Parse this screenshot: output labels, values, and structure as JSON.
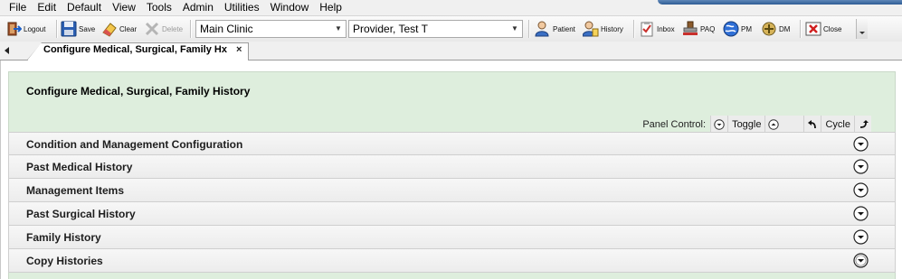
{
  "menu": [
    "File",
    "Edit",
    "Default",
    "View",
    "Tools",
    "Admin",
    "Utilities",
    "Window",
    "Help"
  ],
  "toolbar": {
    "logout": "Logout",
    "save": "Save",
    "clear": "Clear",
    "delete": "Delete",
    "clinic_value": "Main Clinic",
    "provider_value": "Provider, Test T",
    "patient": "Patient",
    "history": "History",
    "inbox": "Inbox",
    "paq": "PAQ",
    "pm": "PM",
    "dm": "DM",
    "close": "Close"
  },
  "tab": {
    "label": "Configure Medical, Surgical, Family Hx",
    "close": "×"
  },
  "page": {
    "title": "Configure Medical, Surgical, Family History",
    "panel_control": {
      "label": "Panel Control:",
      "toggle": "Toggle",
      "cycle": "Cycle"
    }
  },
  "sections": [
    "Condition and Management Configuration",
    "Past Medical History",
    "Management Items",
    "Past Surgical History",
    "Family History",
    "Copy Histories"
  ],
  "colors": {
    "panel_bg": "#deeedd",
    "title_accent": "#2e5c94"
  }
}
